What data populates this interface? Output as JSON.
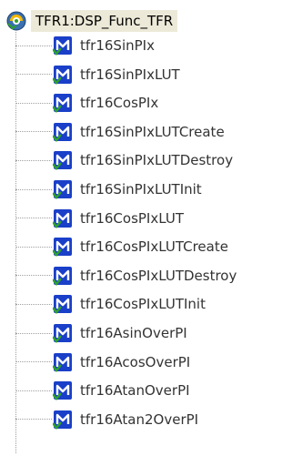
{
  "tree": {
    "root": {
      "label": "TFR1:DSP_Func_TFR",
      "icon": "module-gear-icon"
    },
    "children": [
      {
        "label": "tfr16SinPIx",
        "icon": "method-m-icon"
      },
      {
        "label": "tfr16SinPIxLUT",
        "icon": "method-m-icon"
      },
      {
        "label": "tfr16CosPIx",
        "icon": "method-m-icon"
      },
      {
        "label": "tfr16SinPIxLUTCreate",
        "icon": "method-m-icon"
      },
      {
        "label": "tfr16SinPIxLUTDestroy",
        "icon": "method-m-icon"
      },
      {
        "label": "tfr16SinPIxLUTInit",
        "icon": "method-m-icon"
      },
      {
        "label": "tfr16CosPIxLUT",
        "icon": "method-m-icon"
      },
      {
        "label": "tfr16CosPIxLUTCreate",
        "icon": "method-m-icon"
      },
      {
        "label": "tfr16CosPIxLUTDestroy",
        "icon": "method-m-icon"
      },
      {
        "label": "tfr16CosPIxLUTInit",
        "icon": "method-m-icon"
      },
      {
        "label": "tfr16AsinOverPI",
        "icon": "method-m-icon"
      },
      {
        "label": "tfr16AcosOverPI",
        "icon": "method-m-icon"
      },
      {
        "label": "tfr16AtanOverPI",
        "icon": "method-m-icon"
      },
      {
        "label": "tfr16Atan2OverPI",
        "icon": "method-m-icon"
      }
    ]
  },
  "colors": {
    "icon_blue": "#1a3fc8",
    "icon_check": "#2fa02f",
    "root_highlight": "#ece9d8"
  }
}
